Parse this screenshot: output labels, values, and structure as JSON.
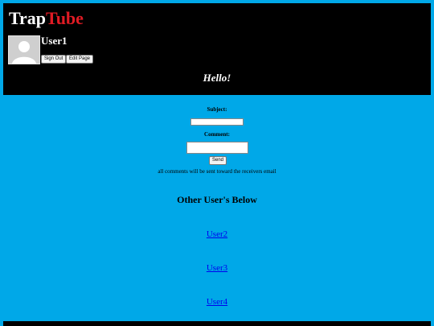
{
  "brand": {
    "part1": "Trap",
    "part2": "Tube"
  },
  "profile": {
    "username": "User1",
    "signout_label": "Sign Out",
    "edit_label": "Edit Page"
  },
  "greeting": "Hello!",
  "message_form": {
    "subject_label": "Subject:",
    "comment_label": "Comment:",
    "subject_value": "",
    "comment_value": "",
    "send_label": "Send",
    "note": "all comments will be sent toward the receivers email"
  },
  "others": {
    "heading": "Other User's Below",
    "users": [
      "User2",
      "User3",
      "User4"
    ]
  },
  "colors": {
    "background": "#00a8e8",
    "header": "#000000",
    "brand_accent": "#e01b24",
    "link": "#0000ee"
  }
}
